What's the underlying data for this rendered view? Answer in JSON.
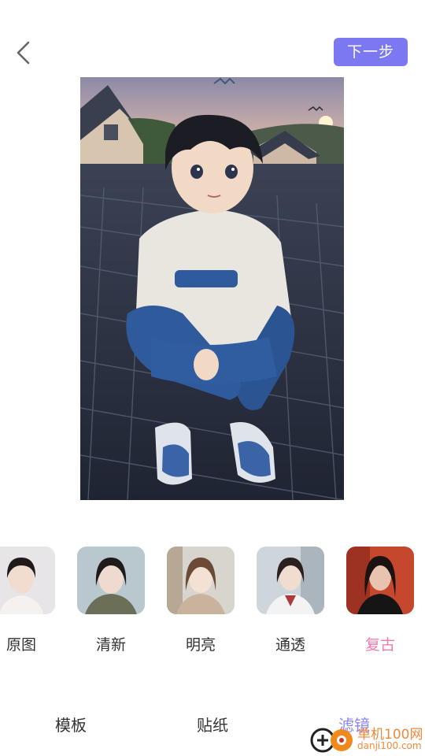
{
  "header": {
    "back_icon": "chevron-left-icon",
    "next_label": "下一步"
  },
  "filters": [
    {
      "label": "原图",
      "selected": false
    },
    {
      "label": "清新",
      "selected": false
    },
    {
      "label": "明亮",
      "selected": false
    },
    {
      "label": "通透",
      "selected": false
    },
    {
      "label": "复古",
      "selected": true
    }
  ],
  "tabs": [
    {
      "label": "模板",
      "selected": false
    },
    {
      "label": "贴纸",
      "selected": false
    },
    {
      "label": "滤镜",
      "selected": true
    }
  ],
  "watermark": {
    "title": "单机100网",
    "url": "danji100.com"
  },
  "colors": {
    "accent": "#7b78f2",
    "selected_filter": "#f07bb0",
    "selected_tab": "#8a87f4"
  }
}
